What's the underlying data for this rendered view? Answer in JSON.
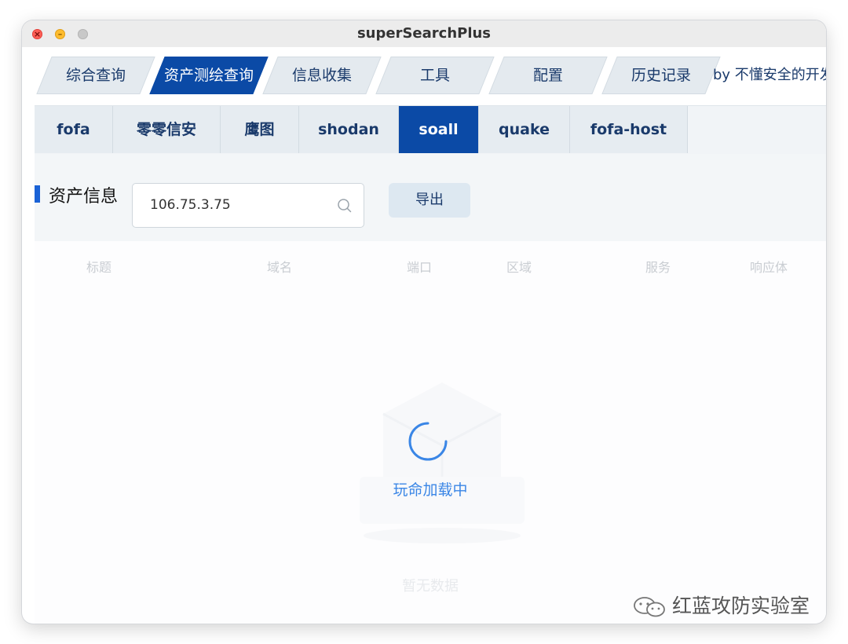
{
  "window": {
    "title": "superSearchPlus",
    "controls": [
      "close",
      "minimize",
      "maximize"
    ],
    "close_glyph": "×",
    "min_glyph": "–"
  },
  "main_tabs": {
    "items": [
      {
        "label": "综合查询",
        "active": false
      },
      {
        "label": "资产测绘查询",
        "active": true
      },
      {
        "label": "信息收集",
        "active": false
      },
      {
        "label": "工具",
        "active": false
      },
      {
        "label": "配置",
        "active": false
      },
      {
        "label": "历史记录",
        "active": false
      }
    ],
    "byline": "by 不懂安全的开发"
  },
  "sub_tabs": {
    "items": [
      {
        "label": "fofa",
        "active": false
      },
      {
        "label": "零零信安",
        "active": false
      },
      {
        "label": "鹰图",
        "active": false
      },
      {
        "label": "shodan",
        "active": false
      },
      {
        "label": "soall",
        "active": true
      },
      {
        "label": "quake",
        "active": false
      },
      {
        "label": "fofa-host",
        "active": false
      }
    ]
  },
  "filter": {
    "label": "资产信息",
    "search_value": "106.75.3.75",
    "search_icon": "search-icon",
    "export_label": "导出"
  },
  "table": {
    "columns": [
      "标题",
      "域名",
      "端口",
      "区域",
      "服务",
      "响应体"
    ],
    "empty_text": "暂无数据"
  },
  "loading": {
    "text": "玩命加载中",
    "color": "#3a86e6"
  },
  "watermark": {
    "text": "红蓝攻防实验室",
    "icon": "wechat-icon"
  },
  "colors": {
    "accent": "#0b4aa6",
    "tab_inactive": "#e4eaef",
    "text_primary": "#1a3a6b"
  }
}
